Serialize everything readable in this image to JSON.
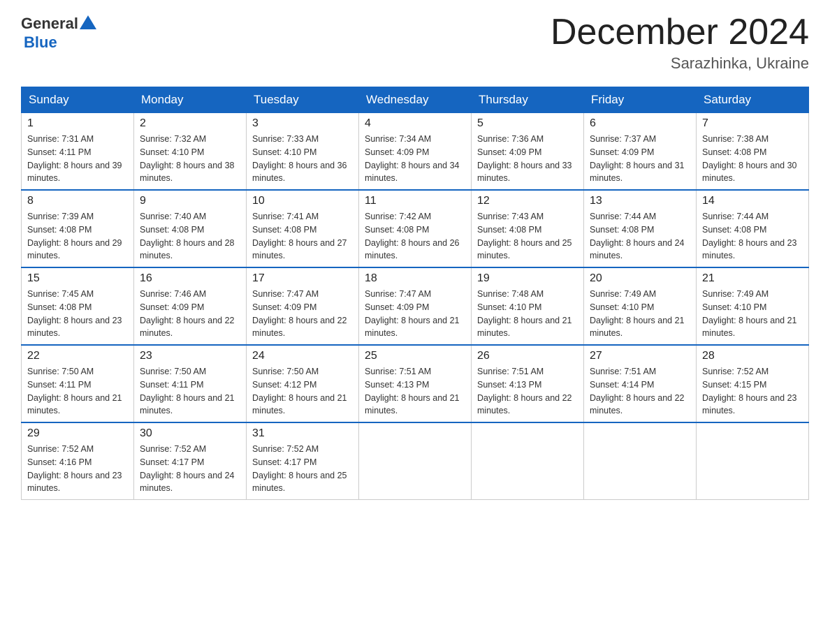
{
  "header": {
    "logo_general": "General",
    "logo_blue": "Blue",
    "month_title": "December 2024",
    "location": "Sarazhinka, Ukraine"
  },
  "days_of_week": [
    "Sunday",
    "Monday",
    "Tuesday",
    "Wednesday",
    "Thursday",
    "Friday",
    "Saturday"
  ],
  "weeks": [
    [
      {
        "day": "1",
        "sunrise": "7:31 AM",
        "sunset": "4:11 PM",
        "daylight": "8 hours and 39 minutes."
      },
      {
        "day": "2",
        "sunrise": "7:32 AM",
        "sunset": "4:10 PM",
        "daylight": "8 hours and 38 minutes."
      },
      {
        "day": "3",
        "sunrise": "7:33 AM",
        "sunset": "4:10 PM",
        "daylight": "8 hours and 36 minutes."
      },
      {
        "day": "4",
        "sunrise": "7:34 AM",
        "sunset": "4:09 PM",
        "daylight": "8 hours and 34 minutes."
      },
      {
        "day": "5",
        "sunrise": "7:36 AM",
        "sunset": "4:09 PM",
        "daylight": "8 hours and 33 minutes."
      },
      {
        "day": "6",
        "sunrise": "7:37 AM",
        "sunset": "4:09 PM",
        "daylight": "8 hours and 31 minutes."
      },
      {
        "day": "7",
        "sunrise": "7:38 AM",
        "sunset": "4:08 PM",
        "daylight": "8 hours and 30 minutes."
      }
    ],
    [
      {
        "day": "8",
        "sunrise": "7:39 AM",
        "sunset": "4:08 PM",
        "daylight": "8 hours and 29 minutes."
      },
      {
        "day": "9",
        "sunrise": "7:40 AM",
        "sunset": "4:08 PM",
        "daylight": "8 hours and 28 minutes."
      },
      {
        "day": "10",
        "sunrise": "7:41 AM",
        "sunset": "4:08 PM",
        "daylight": "8 hours and 27 minutes."
      },
      {
        "day": "11",
        "sunrise": "7:42 AM",
        "sunset": "4:08 PM",
        "daylight": "8 hours and 26 minutes."
      },
      {
        "day": "12",
        "sunrise": "7:43 AM",
        "sunset": "4:08 PM",
        "daylight": "8 hours and 25 minutes."
      },
      {
        "day": "13",
        "sunrise": "7:44 AM",
        "sunset": "4:08 PM",
        "daylight": "8 hours and 24 minutes."
      },
      {
        "day": "14",
        "sunrise": "7:44 AM",
        "sunset": "4:08 PM",
        "daylight": "8 hours and 23 minutes."
      }
    ],
    [
      {
        "day": "15",
        "sunrise": "7:45 AM",
        "sunset": "4:08 PM",
        "daylight": "8 hours and 23 minutes."
      },
      {
        "day": "16",
        "sunrise": "7:46 AM",
        "sunset": "4:09 PM",
        "daylight": "8 hours and 22 minutes."
      },
      {
        "day": "17",
        "sunrise": "7:47 AM",
        "sunset": "4:09 PM",
        "daylight": "8 hours and 22 minutes."
      },
      {
        "day": "18",
        "sunrise": "7:47 AM",
        "sunset": "4:09 PM",
        "daylight": "8 hours and 21 minutes."
      },
      {
        "day": "19",
        "sunrise": "7:48 AM",
        "sunset": "4:10 PM",
        "daylight": "8 hours and 21 minutes."
      },
      {
        "day": "20",
        "sunrise": "7:49 AM",
        "sunset": "4:10 PM",
        "daylight": "8 hours and 21 minutes."
      },
      {
        "day": "21",
        "sunrise": "7:49 AM",
        "sunset": "4:10 PM",
        "daylight": "8 hours and 21 minutes."
      }
    ],
    [
      {
        "day": "22",
        "sunrise": "7:50 AM",
        "sunset": "4:11 PM",
        "daylight": "8 hours and 21 minutes."
      },
      {
        "day": "23",
        "sunrise": "7:50 AM",
        "sunset": "4:11 PM",
        "daylight": "8 hours and 21 minutes."
      },
      {
        "day": "24",
        "sunrise": "7:50 AM",
        "sunset": "4:12 PM",
        "daylight": "8 hours and 21 minutes."
      },
      {
        "day": "25",
        "sunrise": "7:51 AM",
        "sunset": "4:13 PM",
        "daylight": "8 hours and 21 minutes."
      },
      {
        "day": "26",
        "sunrise": "7:51 AM",
        "sunset": "4:13 PM",
        "daylight": "8 hours and 22 minutes."
      },
      {
        "day": "27",
        "sunrise": "7:51 AM",
        "sunset": "4:14 PM",
        "daylight": "8 hours and 22 minutes."
      },
      {
        "day": "28",
        "sunrise": "7:52 AM",
        "sunset": "4:15 PM",
        "daylight": "8 hours and 23 minutes."
      }
    ],
    [
      {
        "day": "29",
        "sunrise": "7:52 AM",
        "sunset": "4:16 PM",
        "daylight": "8 hours and 23 minutes."
      },
      {
        "day": "30",
        "sunrise": "7:52 AM",
        "sunset": "4:17 PM",
        "daylight": "8 hours and 24 minutes."
      },
      {
        "day": "31",
        "sunrise": "7:52 AM",
        "sunset": "4:17 PM",
        "daylight": "8 hours and 25 minutes."
      },
      null,
      null,
      null,
      null
    ]
  ]
}
